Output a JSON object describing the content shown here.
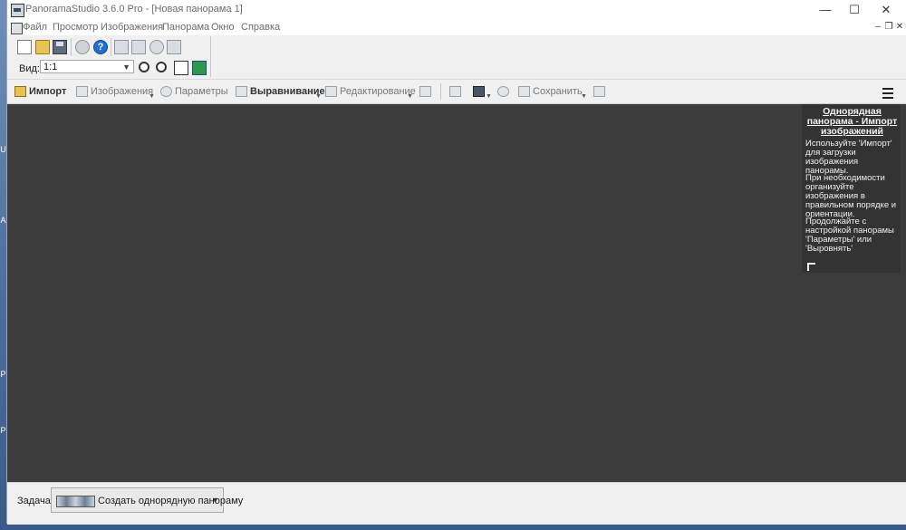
{
  "window": {
    "title": "PanoramaStudio 3.6.0 Pro - [Новая панорама 1]",
    "controls": {
      "minimize": "—",
      "maximize": "☐",
      "close": "✕"
    }
  },
  "menubar": {
    "items": [
      "Файл",
      "Просмотр",
      "Изображения",
      "Панорама",
      "Окно",
      "Справка"
    ],
    "mdi_controls": {
      "minimize": "–",
      "restore": "❐",
      "close": "✕"
    }
  },
  "toolbar": {
    "view_label": "Вид:",
    "zoom_value": "1:1"
  },
  "workflow": {
    "items": [
      {
        "label": "Импорт",
        "icon": "import-icon"
      },
      {
        "label": "Изображения",
        "icon": "images-icon"
      },
      {
        "label": "Параметры",
        "icon": "parameters-icon"
      },
      {
        "label": "Выравнивание",
        "icon": "align-icon"
      },
      {
        "label": "Редактирование",
        "icon": "edit-icon"
      },
      {
        "label": "Сохранить",
        "icon": "save-icon"
      }
    ]
  },
  "side_panel": {
    "title": "Однорядная панорама - Импорт изображений",
    "paragraphs": [
      "Используйте 'Импорт' для загрузки изображения панорамы.",
      "При необходимости организуйте изображения в правильном порядке и ориентации.",
      "Продолжайте с настройкой панорамы 'Параметры' или 'Выровнять'"
    ]
  },
  "task": {
    "label": "Задача:",
    "value": "Создать однорядную панораму"
  },
  "colors": {
    "workspace": "#3c3c3c",
    "side_panel": "#333333",
    "chrome": "#f0f0f0"
  }
}
